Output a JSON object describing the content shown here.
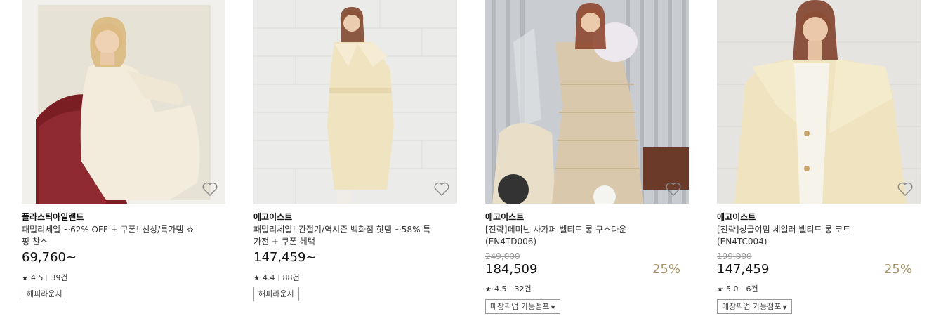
{
  "products": [
    {
      "brand": "플라스틱아일랜드",
      "title": "패밀리세일 ~62% OFF + 쿠폰! 신상/특가템 쇼핑 찬스",
      "price": "69,760~",
      "rating": "4.5",
      "review_count": "39건",
      "tag": "해피라운지",
      "image_alt": "woman in cream dress sitting on red chair"
    },
    {
      "brand": "에고이스트",
      "title": "패밀리세일! 간절기/역시즌 백화점 핫템 ~58% 특가전 + 쿠폰 혜택",
      "price": "147,459~",
      "rating": "4.4",
      "review_count": "88건",
      "tag": "해피라운지",
      "image_alt": "woman in cream belted wool coat"
    },
    {
      "brand": "에고이스트",
      "title": "[전략]페미닌 사가퍼 벨티드 롱 구스다운 (EN4TD006)",
      "original_price": "249,000",
      "price": "184,509",
      "discount": "25%",
      "rating": "4.5",
      "review_count": "32건",
      "tag": "매장픽업 가능점포",
      "image_alt": "woman in beige long down jacket with fur hood beside scooter"
    },
    {
      "brand": "에고이스트",
      "title": "[전략]싱글여밈 세일러 벨티드 롱 코트 (EN4TC004)",
      "original_price": "199,000",
      "price": "147,459",
      "discount": "25%",
      "rating": "5.0",
      "review_count": "6건",
      "tag": "매장픽업 가능점포",
      "image_alt": "woman in cream sailor collar coat"
    }
  ],
  "icons": {
    "wishlist": "heart-outline-icon",
    "rating": "star-icon",
    "dropdown": "caret-down-icon"
  },
  "colors": {
    "discount": "#a8946a",
    "strikethrough_price": "#999999",
    "tag_border": "#999999"
  }
}
